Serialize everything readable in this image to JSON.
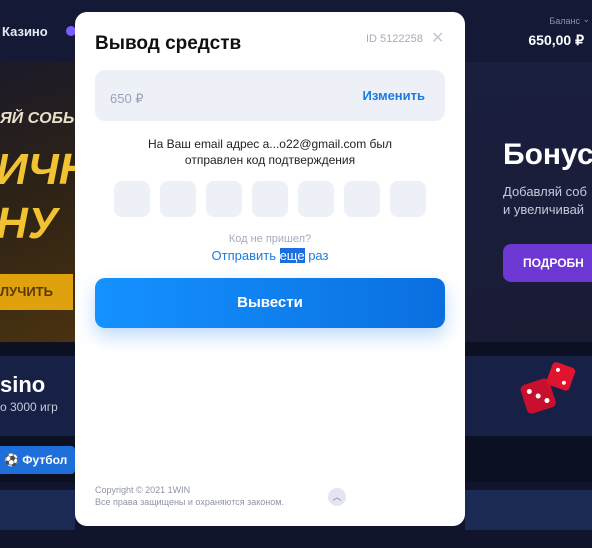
{
  "background": {
    "topbar": {
      "casino_label": "Казино",
      "balance_label": "Баланс",
      "balance_value": "650,00 ₽"
    },
    "left_banner": {
      "line1": "ЯЙ СОБЫ",
      "line2": "ИЧН",
      "line3": "НУ",
      "button": "ЛУЧИТЬ"
    },
    "right_banner": {
      "heading": "Бонус",
      "desc1": "Добавляй соб",
      "desc2": "и увеличивай",
      "button": "ПОДРОБН"
    },
    "casino_card": {
      "title": "sino",
      "subtitle": "о 3000 игр"
    },
    "football_tab": "Футбол"
  },
  "modal": {
    "title": "Вывод средств",
    "id_label": "ID 5122258",
    "close_icon": "close-icon",
    "amount": {
      "value": "650 ₽",
      "change_label": "Изменить"
    },
    "notice_line1": "На Ваш email адрес a...o22@gmail.com был",
    "notice_line2": "отправлен код подтверждения",
    "code_cells": [
      "",
      "",
      "",
      "",
      "",
      "",
      ""
    ],
    "no_code": "Код не пришел?",
    "resend": {
      "part1": "Отправить ",
      "part2": "еще",
      "part3": " раз"
    },
    "submit_label": "Вывести",
    "copyright_line1": "Copyright © 2021 1WIN",
    "copyright_line2": "Все права защищены и охраняются законом.",
    "scroll_top_icon": "chevron-up-icon"
  },
  "colors": {
    "accent": "#1a7ce0",
    "button": "#1592ff",
    "overlay": "#0b1022"
  }
}
